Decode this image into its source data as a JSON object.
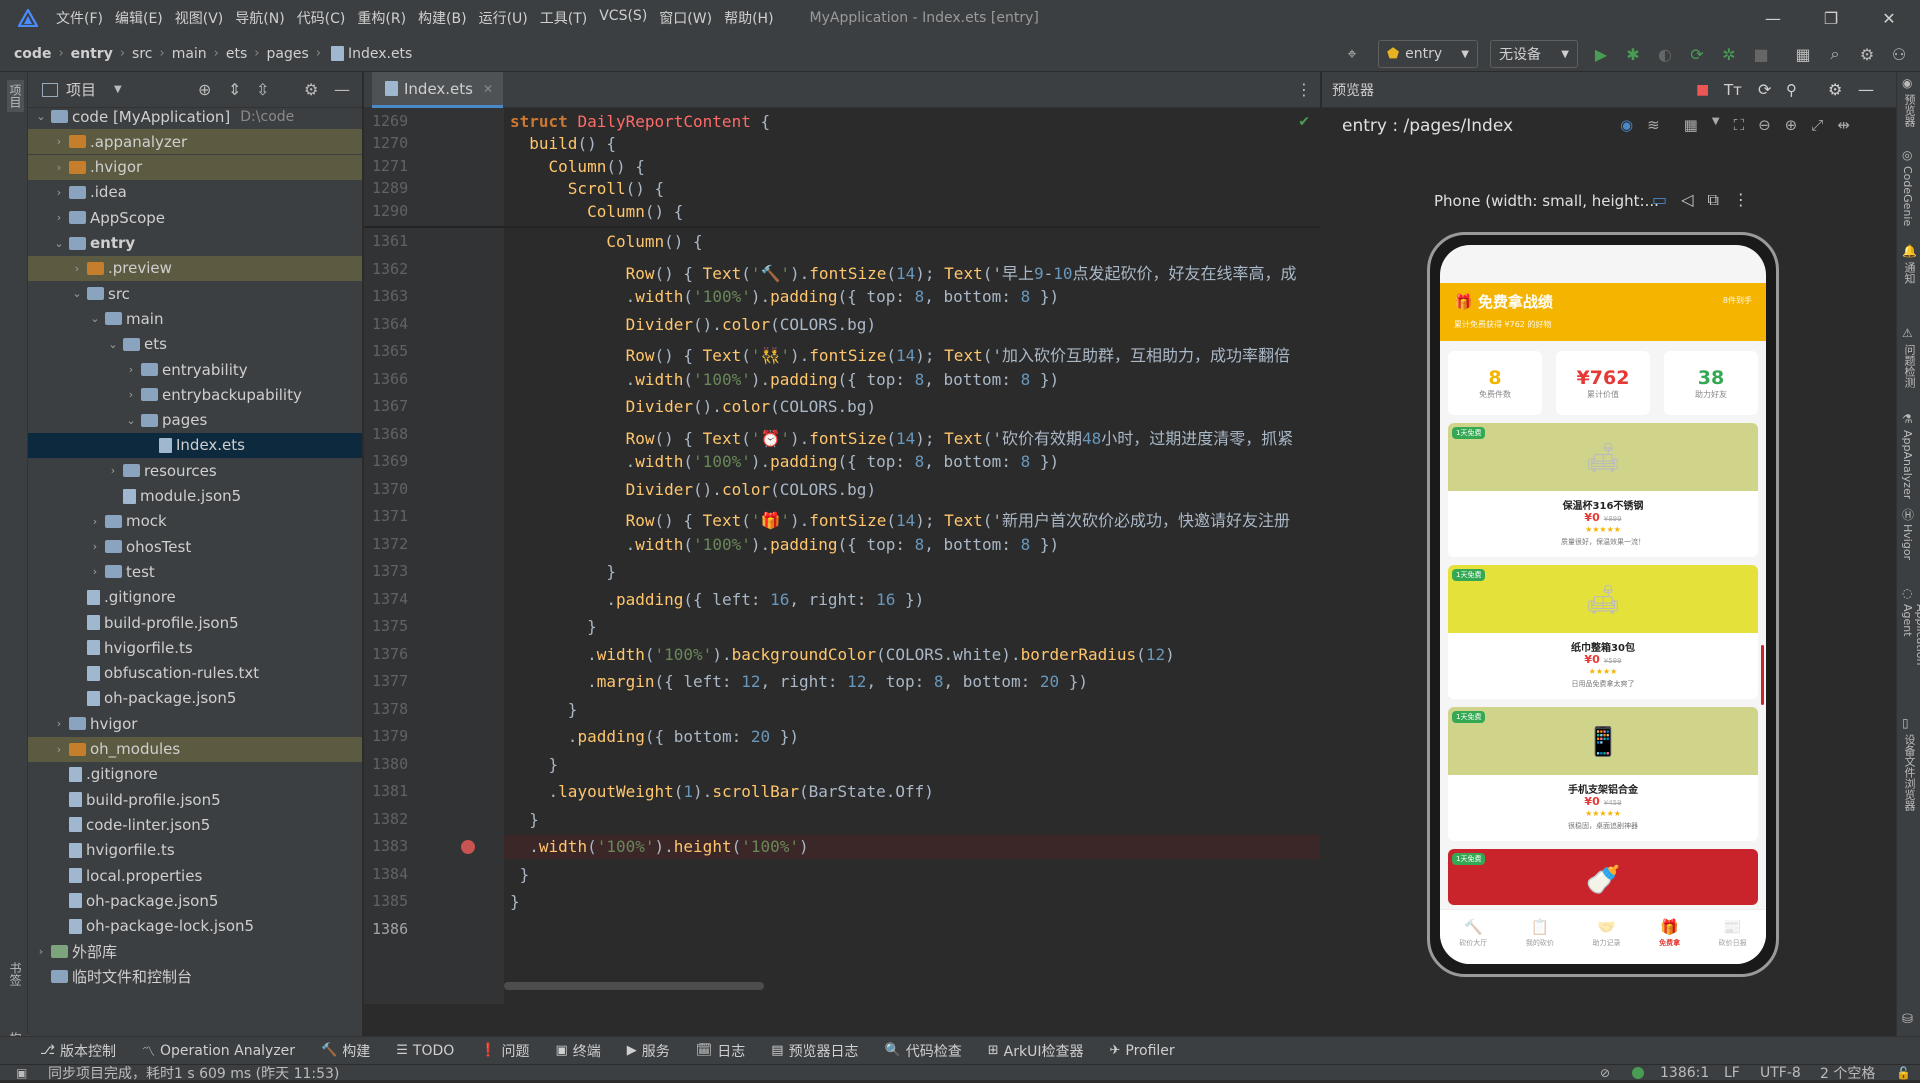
{
  "app": {
    "window_title": "MyApplication - Index.ets [entry]"
  },
  "menu": [
    "文件(F)",
    "编辑(E)",
    "视图(V)",
    "导航(N)",
    "代码(C)",
    "重构(R)",
    "构建(B)",
    "运行(U)",
    "工具(T)",
    "VCS(S)",
    "窗口(W)",
    "帮助(H)"
  ],
  "breadcrumb": [
    "code",
    "entry",
    "src",
    "main",
    "ets",
    "pages",
    "Index.ets"
  ],
  "toolbar": {
    "run_config": "entry",
    "device": "无设备"
  },
  "project_panel": {
    "title": "项目",
    "tree": [
      {
        "label": "code [MyApplication]",
        "hint": "D:\\code",
        "depth": 0,
        "type": "folder",
        "expanded": true
      },
      {
        "label": ".appanalyzer",
        "depth": 1,
        "type": "folder-excl",
        "expanded": false
      },
      {
        "label": ".hvigor",
        "depth": 1,
        "type": "folder-excl",
        "expanded": false
      },
      {
        "label": ".idea",
        "depth": 1,
        "type": "folder",
        "expanded": false
      },
      {
        "label": "AppScope",
        "depth": 1,
        "type": "folder",
        "expanded": false
      },
      {
        "label": "entry",
        "depth": 1,
        "type": "folder",
        "expanded": true,
        "bold": true
      },
      {
        "label": ".preview",
        "depth": 2,
        "type": "folder-excl",
        "expanded": false
      },
      {
        "label": "src",
        "depth": 2,
        "type": "folder",
        "expanded": true
      },
      {
        "label": "main",
        "depth": 3,
        "type": "folder",
        "expanded": true
      },
      {
        "label": "ets",
        "depth": 4,
        "type": "folder",
        "expanded": true
      },
      {
        "label": "entryability",
        "depth": 5,
        "type": "folder",
        "expanded": false
      },
      {
        "label": "entrybackupability",
        "depth": 5,
        "type": "folder",
        "expanded": false
      },
      {
        "label": "pages",
        "depth": 5,
        "type": "folder",
        "expanded": true
      },
      {
        "label": "Index.ets",
        "depth": 6,
        "type": "file",
        "selected": true
      },
      {
        "label": "resources",
        "depth": 4,
        "type": "folder",
        "expanded": false
      },
      {
        "label": "module.json5",
        "depth": 4,
        "type": "file"
      },
      {
        "label": "mock",
        "depth": 3,
        "type": "folder",
        "expanded": false
      },
      {
        "label": "ohosTest",
        "depth": 3,
        "type": "folder",
        "expanded": false
      },
      {
        "label": "test",
        "depth": 3,
        "type": "folder",
        "expanded": false
      },
      {
        "label": ".gitignore",
        "depth": 2,
        "type": "file"
      },
      {
        "label": "build-profile.json5",
        "depth": 2,
        "type": "file"
      },
      {
        "label": "hvigorfile.ts",
        "depth": 2,
        "type": "file"
      },
      {
        "label": "obfuscation-rules.txt",
        "depth": 2,
        "type": "file"
      },
      {
        "label": "oh-package.json5",
        "depth": 2,
        "type": "file"
      },
      {
        "label": "hvigor",
        "depth": 1,
        "type": "folder",
        "expanded": false
      },
      {
        "label": "oh_modules",
        "depth": 1,
        "type": "folder-excl",
        "expanded": false
      },
      {
        "label": ".gitignore",
        "depth": 1,
        "type": "file"
      },
      {
        "label": "build-profile.json5",
        "depth": 1,
        "type": "file"
      },
      {
        "label": "code-linter.json5",
        "depth": 1,
        "type": "file"
      },
      {
        "label": "hvigorfile.ts",
        "depth": 1,
        "type": "file"
      },
      {
        "label": "local.properties",
        "depth": 1,
        "type": "file"
      },
      {
        "label": "oh-package.json5",
        "depth": 1,
        "type": "file"
      },
      {
        "label": "oh-package-lock.json5",
        "depth": 1,
        "type": "file"
      },
      {
        "label": "外部库",
        "depth": 0,
        "type": "lib",
        "expanded": false
      },
      {
        "label": "临时文件和控制台",
        "depth": 0,
        "type": "scratch"
      }
    ]
  },
  "editor": {
    "tab": "Index.ets",
    "sticky_lines": [
      {
        "n": "1269",
        "code": "struct DailyReportContent {"
      },
      {
        "n": "1270",
        "code": "  build() {"
      },
      {
        "n": "1271",
        "code": "    Column() {"
      },
      {
        "n": "1289",
        "code": "      Scroll() {"
      },
      {
        "n": "1290",
        "code": "        Column() {"
      }
    ],
    "lines": [
      {
        "n": "1361",
        "code": "          Column() {"
      },
      {
        "n": "1362",
        "code": "            Row() { Text('🔨').fontSize(14); Text('早上9-10点发起砍价，好友在线率高，成"
      },
      {
        "n": "1363",
        "code": "            .width('100%').padding({ top: 8, bottom: 8 })"
      },
      {
        "n": "1364",
        "code": "            Divider().color(COLORS.bg)"
      },
      {
        "n": "1365",
        "code": "            Row() { Text('👯').fontSize(14); Text('加入砍价互助群，互相助力，成功率翻倍"
      },
      {
        "n": "1366",
        "code": "            .width('100%').padding({ top: 8, bottom: 8 })"
      },
      {
        "n": "1367",
        "code": "            Divider().color(COLORS.bg)"
      },
      {
        "n": "1368",
        "code": "            Row() { Text('⏰').fontSize(14); Text('砍价有效期48小时，过期进度清零，抓紧"
      },
      {
        "n": "1369",
        "code": "            .width('100%').padding({ top: 8, bottom: 8 })"
      },
      {
        "n": "1370",
        "code": "            Divider().color(COLORS.bg)"
      },
      {
        "n": "1371",
        "code": "            Row() { Text('🎁').fontSize(14); Text('新用户首次砍价必成功，快邀请好友注册"
      },
      {
        "n": "1372",
        "code": "            .width('100%').padding({ top: 8, bottom: 8 })"
      },
      {
        "n": "1373",
        "code": "          }"
      },
      {
        "n": "1374",
        "code": "          .padding({ left: 16, right: 16 })"
      },
      {
        "n": "1375",
        "code": "        }"
      },
      {
        "n": "1376",
        "code": "        .width('100%').backgroundColor(COLORS.white).borderRadius(12)"
      },
      {
        "n": "1377",
        "code": "        .margin({ left: 12, right: 12, top: 8, bottom: 20 })"
      },
      {
        "n": "1378",
        "code": "      }"
      },
      {
        "n": "1379",
        "code": "      .padding({ bottom: 20 })"
      },
      {
        "n": "1380",
        "code": "    }"
      },
      {
        "n": "1381",
        "code": "    .layoutWeight(1).scrollBar(BarState.Off)"
      },
      {
        "n": "1382",
        "code": "  }"
      },
      {
        "n": "1383",
        "code": "  .width('100%').height('100%')"
      },
      {
        "n": "1384",
        "code": " }"
      },
      {
        "n": "1385",
        "code": "}"
      },
      {
        "n": "1386",
        "code": ""
      }
    ]
  },
  "previewer": {
    "title": "预览器",
    "route": "entry : /pages/Index",
    "device_label": "Phone (width: small, height:...",
    "phone": {
      "header_title": "免费拿战绩",
      "header_sub": "累计免费获得 ¥762 的好物",
      "header_right": "8件到手",
      "stats": [
        {
          "value": "8",
          "label": "免费件数",
          "color": "#f4b400"
        },
        {
          "value": "¥762",
          "label": "累计价值",
          "color": "#e53935"
        },
        {
          "value": "38",
          "label": "助力好友",
          "color": "#35a853"
        }
      ],
      "cards": [
        {
          "tag": "1天免费",
          "name": "保温杯316不锈钢",
          "price": "¥0",
          "orig": "¥899",
          "stars": "★★★★★",
          "desc": "质量很好，保温效果一流！",
          "bg": "#cfd48a",
          "icon": "🛋"
        },
        {
          "tag": "1天免费",
          "name": "纸巾整箱30包",
          "price": "¥0",
          "orig": "¥599",
          "stars": "★★★★",
          "desc": "日用品免费拿太爽了",
          "bg": "#e4e23a",
          "icon": "🛋"
        },
        {
          "tag": "1天免费",
          "name": "手机支架铝合金",
          "price": "¥0",
          "orig": "¥459",
          "stars": "★★★★★",
          "desc": "很稳固，桌面追剧神器",
          "bg": "#cfd48a",
          "icon": "📱"
        },
        {
          "tag": "1天免费",
          "name": "",
          "price": "",
          "orig": "",
          "stars": "",
          "desc": "",
          "bg": "#c9242b",
          "icon": "🍼"
        }
      ],
      "tabs": [
        {
          "icon": "🔨",
          "label": "砍价大厅"
        },
        {
          "icon": "📋",
          "label": "我的砍价"
        },
        {
          "icon": "🤝",
          "label": "助力记录"
        },
        {
          "icon": "🎁",
          "label": "免费拿",
          "active": true
        },
        {
          "icon": "📰",
          "label": "砍价日报"
        }
      ]
    }
  },
  "bottom_tools": [
    {
      "icon": "⎇",
      "label": "版本控制"
    },
    {
      "icon": "〽",
      "label": "Operation Analyzer"
    },
    {
      "icon": "🔨",
      "label": "构建"
    },
    {
      "icon": "☰",
      "label": "TODO"
    },
    {
      "icon": "❗",
      "label": "问题"
    },
    {
      "icon": "▣",
      "label": "终端"
    },
    {
      "icon": "▶",
      "label": "服务"
    },
    {
      "icon": "🗓",
      "label": "日志"
    },
    {
      "icon": "▤",
      "label": "预览器日志"
    },
    {
      "icon": "🔍",
      "label": "代码检查"
    },
    {
      "icon": "⊞",
      "label": "ArkUI检查器"
    },
    {
      "icon": "✈",
      "label": "Profiler"
    }
  ],
  "status": {
    "message": "同步项目完成，耗时1 s 609 ms (昨天 11:53)",
    "position": "1386:1",
    "line_sep": "LF",
    "encoding": "UTF-8",
    "indent": "2 个空格"
  },
  "left_tool_labels": [
    "项目",
    "书签",
    "结构"
  ],
  "right_tool_labels": [
    "预览器",
    "CodeGenie",
    "通知",
    "问题检测",
    "AppAnalyzer",
    "Hvigor",
    "Application Agent",
    "设备文件浏览器"
  ],
  "colors": {
    "accent": "#4a88c7",
    "bg_panel": "#3c3f41",
    "bg_editor": "#2b2b2b",
    "header_yellow": "#f4b400"
  }
}
